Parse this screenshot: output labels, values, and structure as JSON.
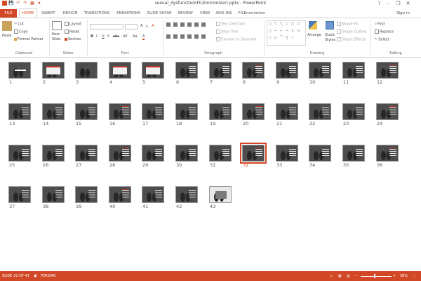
{
  "window": {
    "title": "sexual_dysfunction(FILEminimizer).pptx - PowerPoint",
    "question": "?",
    "minimize": "–",
    "restore": "❐",
    "close": "✕",
    "sign_in": "Sign in"
  },
  "qat": {
    "save": "💾",
    "undo": "↶",
    "redo": "↷",
    "start": "▦",
    "customize": "▾"
  },
  "tabs": [
    "FILE",
    "HOME",
    "INSERT",
    "DESIGN",
    "TRANSITIONS",
    "ANIMATIONS",
    "SLIDE SHOW",
    "REVIEW",
    "VIEW",
    "ADD-INS",
    "FILEminimizer"
  ],
  "active_tab": "HOME",
  "ribbon": {
    "clipboard": {
      "label": "Clipboard",
      "paste": "Paste",
      "cut": "Cut",
      "copy": "Copy",
      "format_painter": "Format Painter"
    },
    "slides": {
      "label": "Slides",
      "new_slide": "New",
      "new_slide2": "Slide",
      "layout": "Layout",
      "reset": "Reset",
      "section": "Section"
    },
    "font": {
      "label": "Font",
      "bold": "B",
      "italic": "I",
      "underline": "U",
      "strike": "S",
      "abc": "abc",
      "av": "AV",
      "aa": "Aa",
      "fontcolor": "A",
      "grow": "A",
      "shrink": "A",
      "clear": "A"
    },
    "paragraph": {
      "label": "Paragraph",
      "text_direction": "Text Direction",
      "align_text": "Align Text",
      "convert_smartart": "Convert to SmartArt"
    },
    "drawing": {
      "label": "Drawing",
      "arrange": "Arrange",
      "quick_styles": "Quick",
      "quick_styles2": "Styles",
      "shape_fill": "Shape Fill",
      "shape_outline": "Shape Outline",
      "shape_effects": "Shape Effects",
      "shapes": [
        "▭",
        "╲",
        "╲",
        "▭",
        "○",
        "▭",
        "△",
        "⌐",
        "⌐",
        "⇨",
        "⇩",
        "◁",
        "▱",
        "▷",
        "⌒",
        "{",
        "☆"
      ]
    },
    "editing": {
      "label": "Editing",
      "find": "Find",
      "replace": "Replace",
      "select": "Select"
    }
  },
  "slides": [
    "1",
    "2",
    "3",
    "4",
    "5",
    "6",
    "7",
    "8",
    "9",
    "10",
    "11",
    "12",
    "13",
    "14",
    "15",
    "16",
    "17",
    "18",
    "19",
    "20",
    "21",
    "22",
    "23",
    "24",
    "25",
    "26",
    "27",
    "28",
    "29",
    "30",
    "31",
    "32",
    "33",
    "34",
    "35",
    "36",
    "37",
    "38",
    "39",
    "40",
    "41",
    "42",
    "43"
  ],
  "selected_slide": 32,
  "status": {
    "slide": "SLIDE 32 OF 43",
    "language": "PERSIAN",
    "zoom": "38%",
    "zoom_minus": "−",
    "zoom_plus": "+"
  },
  "colors": {
    "accent": "#d24726"
  }
}
